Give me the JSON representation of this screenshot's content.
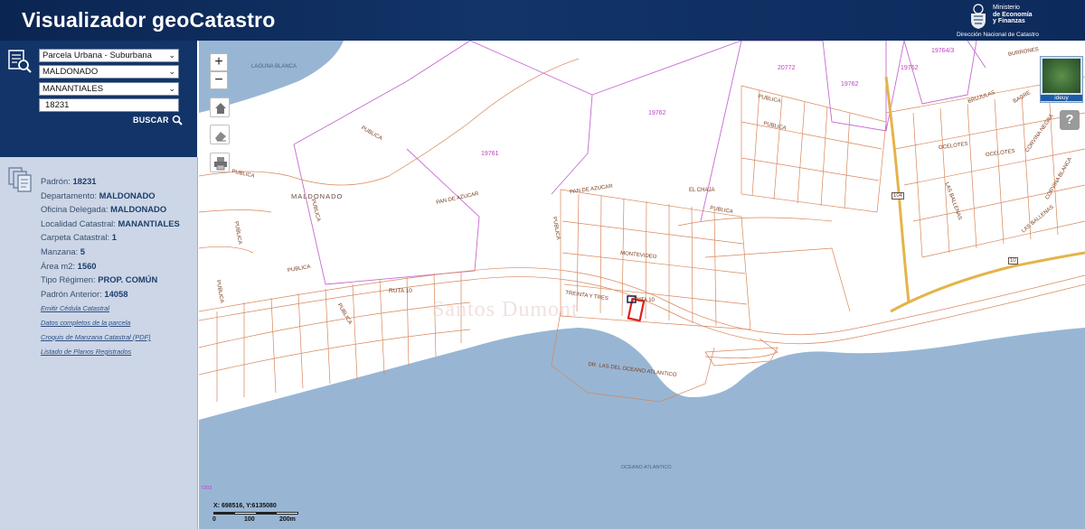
{
  "header": {
    "title": "Visualizador geoCatastro",
    "ministry_line1": "Ministerio",
    "ministry_line2": "de Economía",
    "ministry_line3": "y Finanzas",
    "ministry_sub": "Dirección Nacional de Catastro"
  },
  "search": {
    "parcel_type": "Parcela Urbana - Suburbana",
    "department": "MALDONADO",
    "locality": "MANANTIALES",
    "padron_value": "18231",
    "search_label": "BUSCAR"
  },
  "info": {
    "rows": [
      {
        "label": "Padrón:",
        "value": "18231"
      },
      {
        "label": "Departamento:",
        "value": "MALDONADO"
      },
      {
        "label": "Oficina Delegada:",
        "value": "MALDONADO"
      },
      {
        "label": "Localidad Catastral:",
        "value": "MANANTIALES"
      },
      {
        "label": "Carpeta Catastral:",
        "value": "1"
      },
      {
        "label": "Manzana:",
        "value": "5"
      },
      {
        "label": "Área m2:",
        "value": "1560"
      },
      {
        "label": "Tipo Régimen:",
        "value": "PROP. COMÚN"
      },
      {
        "label": "Padrón Anterior:",
        "value": "14058"
      }
    ],
    "links": [
      "Emitir Cédula Catastral",
      "Datos completos de la parcela",
      "Croquis de Manzana Catastral (PDF)",
      "Listado de Planos Registrados"
    ]
  },
  "map": {
    "zoom_in": "+",
    "zoom_out": "−",
    "overview_label": "ideuy",
    "help_label": "?",
    "coords": "X: 698516, Y:6135080",
    "scale_labels": [
      "0",
      "100",
      "200m"
    ],
    "watermark": "Santos Dumont",
    "corner_label": "7203",
    "labels": {
      "laguna_blanca": "LAGUNA BLANCA",
      "maldonado": "MALDONADO",
      "ruta10": "RUTA 10",
      "ruta10_b": "RUTA 10",
      "ruta104": "104",
      "ruta10_shield": "10",
      "pan_de_azucar": "PAN DE AZUCAR",
      "pan_de_azucar2": "PAN DE AZUCAR",
      "oceano": "OCEANO ATLANTICO",
      "rambla": "DR. LAS DEL OCEANO ATLANTICO",
      "publica1": "PUBLICA",
      "publica2": "PUBLICA",
      "publica3": "PUBLICA",
      "publica4": "PUBLICA",
      "publica5": "PUBLICA",
      "publica6": "PUBLICA",
      "publica7": "PUBLICA",
      "publica8": "PUBLICA",
      "publica9": "PUBLICA",
      "publica10": "PUBLICA",
      "publica11": "PUBLICA",
      "el_chaja": "EL CHAJA",
      "montevideo": "MONTEVIDEO",
      "treinta_tres": "TREINTA Y TRES",
      "ocelotes": "OCELOTES",
      "ocelotes2": "OCELOTES",
      "brujulas": "BRUJULAS",
      "las_ballenas": "LAS BALLENAS",
      "las_ballenas2": "LAS BALLENAS",
      "corvina_blanca": "CORVINA BLANCA",
      "corvina_negra": "CORVINA NEGRA",
      "burrones": "BURRONES",
      "bagre": "BAGRE"
    },
    "parcels": {
      "p19761": "19761",
      "p19762a": "19762",
      "p20772": "20772",
      "p19762b": "19762",
      "p19762c": "19762",
      "p19764": "19764/3"
    }
  }
}
